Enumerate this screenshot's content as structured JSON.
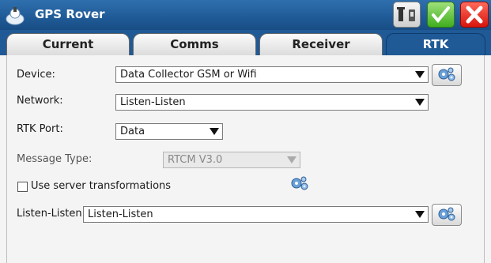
{
  "window": {
    "title": "GPS Rover"
  },
  "tabs": [
    "Current",
    "Comms",
    "Receiver",
    "RTK"
  ],
  "form": {
    "device": {
      "label": "Device:",
      "value": "Data Collector GSM or Wifi"
    },
    "network": {
      "label": "Network:",
      "value": "Listen-Listen"
    },
    "rtk_port": {
      "label": "RTK Port:",
      "value": "Data"
    },
    "message_type": {
      "label": "Message Type:",
      "value": "RTCM V3.0"
    },
    "server_transform": {
      "label": "Use server transformations",
      "checked": false
    },
    "listen": {
      "label": "Listen-Listen:",
      "value": "Listen-Listen"
    }
  },
  "colors": {
    "titlebar": "#1f5a96",
    "ok": "#3fae1e",
    "close": "#d8140c"
  },
  "icons": [
    "gps-rover-icon",
    "receiver-settings-icon",
    "accept-check-icon",
    "close-x-icon",
    "settings-gears-icon"
  ]
}
